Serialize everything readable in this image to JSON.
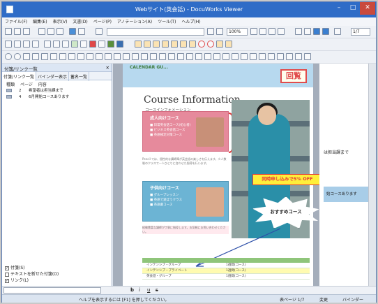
{
  "window": {
    "title": "Webサイト(英会話) - DocuWorks Viewer",
    "min_glyph": "–",
    "max_glyph": "□",
    "close_glyph": "✕"
  },
  "menu": [
    "ファイル(F)",
    "編集(E)",
    "表示(V)",
    "文書(D)",
    "ページ(P)",
    "アノテーション(A)",
    "ツール(T)",
    "ヘルプ(H)"
  ],
  "toolbar": {
    "zoom": "100%",
    "page": "1/7"
  },
  "sidebar": {
    "title": "付箋/リンク一覧",
    "close_glyph": "✕",
    "tabs": [
      "付箋/リンク一覧",
      "バインダー表示",
      "蓄名一覧"
    ],
    "columns": [
      "種類",
      "ページ",
      "内容"
    ],
    "rows": [
      {
        "page": "2",
        "content": "希望者は担当課まで"
      },
      {
        "page": "4",
        "content": "6月開始コースあります"
      }
    ],
    "checks": [
      {
        "label": "付箋(S)",
        "checked": "✓"
      },
      {
        "label": "テキストを新せた付箋(O)",
        "checked": ""
      },
      {
        "label": "リンク(L)",
        "checked": "✓"
      }
    ]
  },
  "document": {
    "banner_text": "CALENDAR GU...",
    "stamp": "回覧",
    "title": "Course Information",
    "subtitle": "コースインフォメーション",
    "box1_label": "成人向けコース",
    "box1_lines": [
      "■ 日常英会話コース(初心者)",
      "■ ビジネス英会話コース",
      "■ 英語検定対策コース"
    ],
    "box2_label": "子供向けコース",
    "box2_lines": [
      "■ グループレッスン",
      "■ 英語で遊ぼうクラス",
      "■ 英語劇コース"
    ],
    "para1": "Pencil では、個性的な講師陣が英会話の楽しさを伝えます。少人数制のクラスで一人ひとりに合わせた指導を行います。",
    "para2": "経験豊富な講師が丁寧に指導します。お気軽にお問い合わせください。",
    "callout_red": "同時申し込みで5% OFF",
    "starburst": "おすすめコース",
    "table_rows": [
      [
        "インテンシブ・グループ",
        "1週間(コース)"
      ],
      [
        "インテンシブ・プライベート",
        "1週間(コース)"
      ],
      [
        "英会話・グループ",
        "1週間(コース)"
      ]
    ],
    "page2_note1": "は担当課まで",
    "page2_note2": "始コースあります"
  },
  "fmtbar": [
    "b",
    "i",
    "u",
    "s"
  ],
  "status": {
    "help": "ヘルプを表示するには [F1] を押してください。",
    "page": "表ページ 1/7",
    "mode": "変更",
    "binder": "バインダー"
  }
}
